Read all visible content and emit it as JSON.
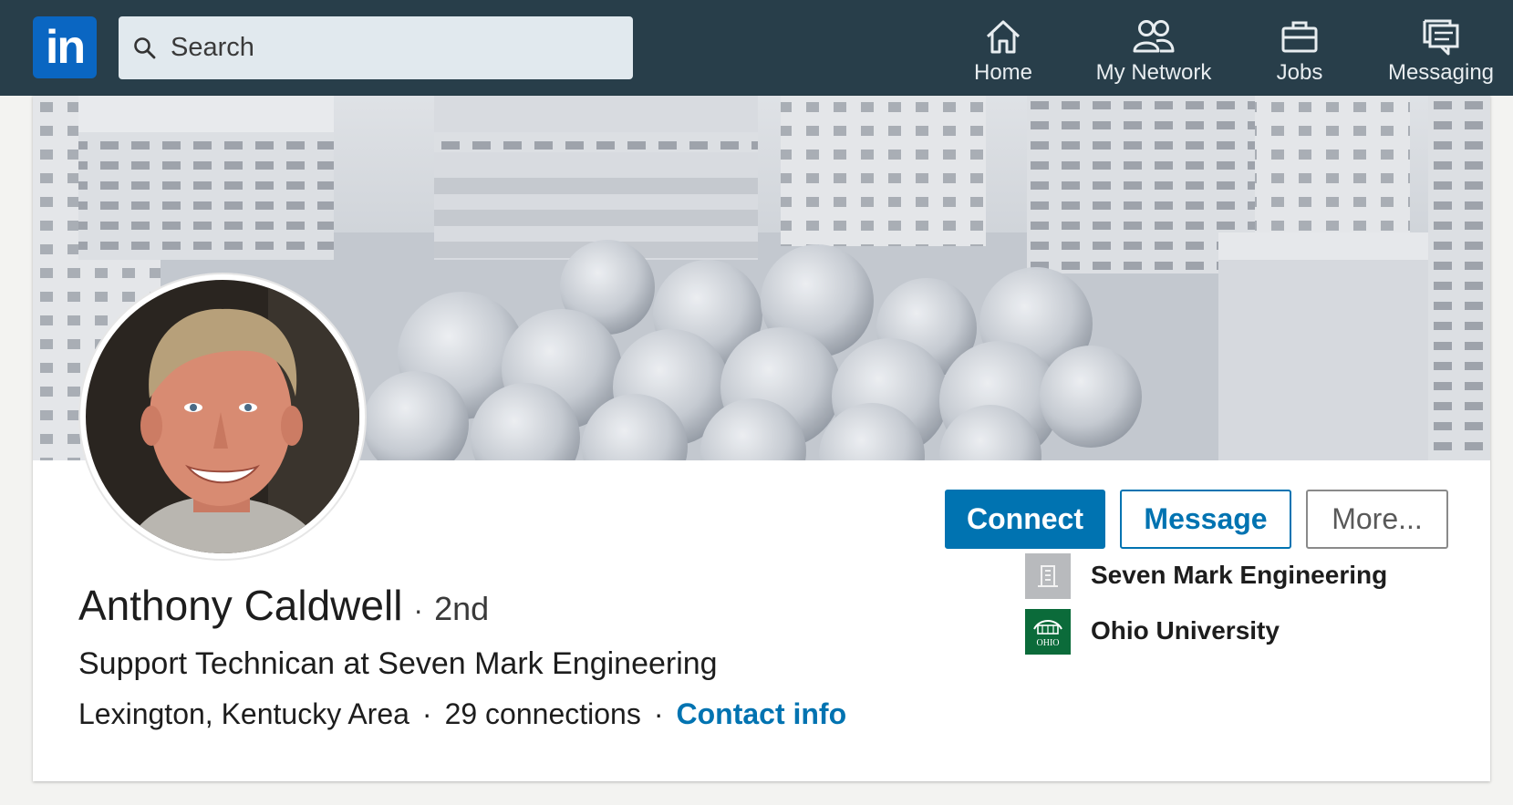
{
  "nav": {
    "logo_text": "in",
    "search_placeholder": "Search",
    "items": [
      {
        "label": "Home",
        "icon": "home-icon"
      },
      {
        "label": "My Network",
        "icon": "network-icon"
      },
      {
        "label": "Jobs",
        "icon": "briefcase-icon"
      },
      {
        "label": "Messaging",
        "icon": "messaging-icon"
      }
    ],
    "colors": {
      "bar": "#283e4a",
      "logo": "#0a66c2"
    }
  },
  "profile": {
    "name": "Anthony Caldwell",
    "degree": "2nd",
    "headline": "Support Technican at Seven Mark Engineering",
    "location": "Lexington, Kentucky Area",
    "connections": "29 connections",
    "contact_label": "Contact info",
    "separator": "·"
  },
  "actions": {
    "connect": "Connect",
    "message": "Message",
    "more": "More..."
  },
  "organizations": [
    {
      "name": "Seven Mark Engineering",
      "icon": "company-placeholder-icon"
    },
    {
      "name": "Ohio University",
      "icon": "ohio-university-logo",
      "logo_text": "OHIO"
    }
  ],
  "colors": {
    "accent": "#0073b1"
  }
}
